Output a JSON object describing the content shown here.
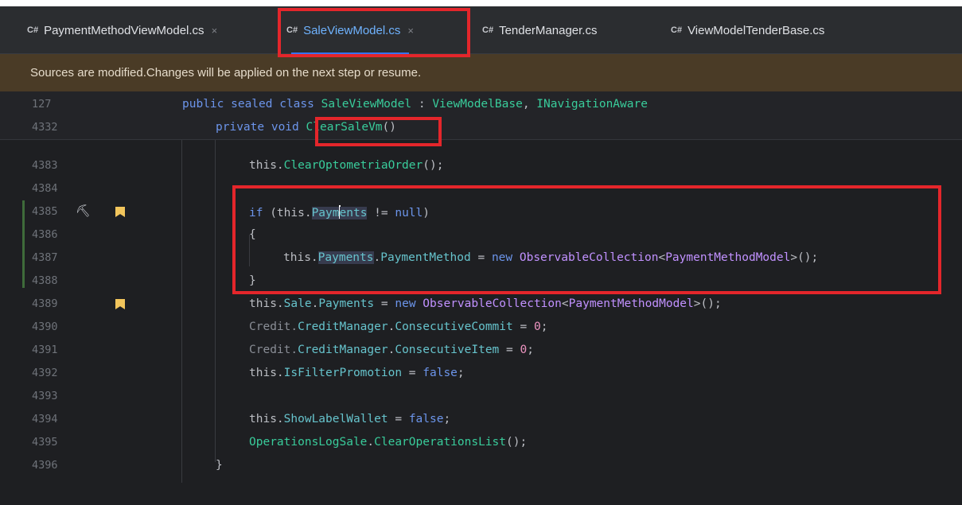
{
  "tabs": [
    {
      "icon": "C#",
      "label": "PaymentMethodViewModel.cs",
      "close": "×",
      "active": false
    },
    {
      "icon": "C#",
      "label": "SaleViewModel.cs",
      "close": "×",
      "active": true
    },
    {
      "icon": "C#",
      "label": "TenderManager.cs",
      "close": "",
      "active": false
    },
    {
      "icon": "C#",
      "label": "ViewModelTenderBase.cs",
      "close": "",
      "active": false
    }
  ],
  "banner": "Sources are modified.Changes will be applied on the next step or resume.",
  "sticky": [
    {
      "num": "127",
      "t1": "public sealed class ",
      "t2": "SaleViewModel",
      "t3": " : ",
      "t4": "ViewModelBase",
      "t5": ", ",
      "t6": "INavigationAware"
    },
    {
      "num": "4332",
      "t1": "private void ",
      "t2": "ClearSaleVm",
      "t3": "()"
    }
  ],
  "lines": {
    "l4383": {
      "num": "4383",
      "a": "this.",
      "b": "ClearOptometriaOrder",
      "c": "();"
    },
    "l4384": {
      "num": "4384"
    },
    "l4385": {
      "num": "4385",
      "a": "if",
      "b": " (this.",
      "c": "Paym",
      "d": "ents",
      "e": " != ",
      "f": "null",
      "g": ")"
    },
    "l4386": {
      "num": "4386",
      "a": "{"
    },
    "l4387": {
      "num": "4387",
      "a": "this.",
      "b": "Payments",
      "c": ".",
      "d": "PaymentMethod",
      "e": " = ",
      "f": "new ",
      "g": "ObservableCollection",
      "h": "<",
      "i": "PaymentMethodModel",
      "j": ">();"
    },
    "l4388": {
      "num": "4388",
      "a": "}"
    },
    "l4389": {
      "num": "4389",
      "a": "this.",
      "b": "Sale",
      "c": ".",
      "d": "Payments",
      "e": " = ",
      "f": "new ",
      "g": "ObservableCollection",
      "h": "<",
      "i": "PaymentMethodModel",
      "j": ">();"
    },
    "l4390": {
      "num": "4390",
      "a": "Credit.",
      "b": "CreditManager",
      "c": ".",
      "d": "ConsecutiveCommit",
      "e": " = ",
      "f": "0",
      "g": ";"
    },
    "l4391": {
      "num": "4391",
      "a": "Credit.",
      "b": "CreditManager",
      "c": ".",
      "d": "ConsecutiveItem",
      "e": " = ",
      "f": "0",
      "g": ";"
    },
    "l4392": {
      "num": "4392",
      "a": "this.",
      "b": "IsFilterPromotion",
      "c": " = ",
      "d": "false",
      "e": ";"
    },
    "l4393": {
      "num": "4393"
    },
    "l4394": {
      "num": "4394",
      "a": "this.",
      "b": "ShowLabelWallet",
      "c": " = ",
      "d": "false",
      "e": ";"
    },
    "l4395": {
      "num": "4395",
      "a": "OperationsLogSale",
      "b": ".",
      "c": "ClearOperationsList",
      "d": "();"
    },
    "l4396": {
      "num": "4396",
      "a": "}"
    }
  },
  "colors": {
    "accent": "#3574f0",
    "highlight_box": "#e4262b",
    "banner_bg": "#4a3b26",
    "bookmark": "#f2c55c"
  },
  "icons": {
    "gutter_icon": "hammer-icon",
    "bookmark": "bookmark-icon"
  }
}
